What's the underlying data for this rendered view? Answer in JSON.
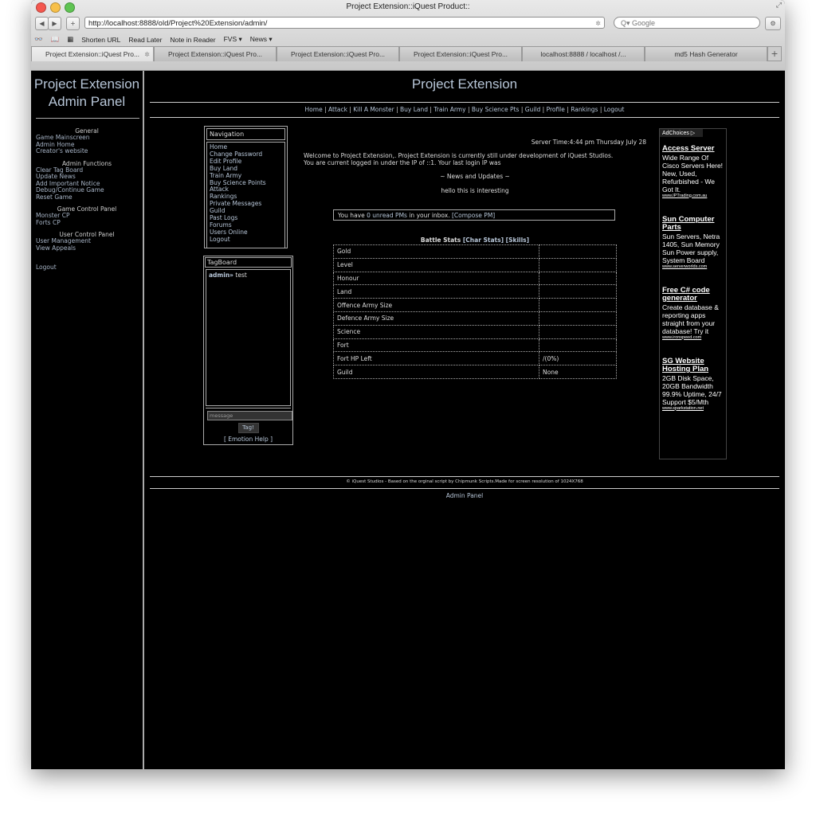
{
  "browser": {
    "title": "Project Extension::iQuest Product::",
    "url": "http://localhost:8888/old/Project%20Extension/admin/",
    "search_placeholder": "Q▾ Google",
    "bookmarks": [
      "Shorten URL",
      "Read Later",
      "Note in Reader",
      "FVS ▾",
      "News ▾"
    ],
    "tabs": [
      "Project Extension::iQuest Pro...",
      "Project Extension::iQuest Pro...",
      "Project Extension::iQuest Pro...",
      "Project Extension::iQuest Pro...",
      "localhost:8888 / localhost /...",
      "md5 Hash Generator"
    ]
  },
  "sidebar": {
    "title_line1": "Project Extension",
    "title_line2": "Admin Panel",
    "sections": [
      {
        "heading": "General",
        "links": [
          "Game Mainscreen",
          "Admin Home",
          "Creator's website"
        ]
      },
      {
        "heading": "Admin Functions",
        "links": [
          "Clear Tag Board",
          "Update News",
          "Add Important Notice",
          "Debug/Continue Game",
          "Reset Game"
        ]
      },
      {
        "heading": "Game Control Panel",
        "links": [
          "Monster CP",
          "Forts CP"
        ]
      },
      {
        "heading": "User Control Panel",
        "links": [
          "User Management",
          "View Appeals"
        ]
      }
    ],
    "logout": "Logout"
  },
  "main": {
    "title": "Project Extension",
    "topnav": [
      "Home",
      "Attack",
      "Kill A Monster",
      "Buy Land",
      "Train Army",
      "Buy Science Pts",
      "Guild",
      "Profile",
      "Rankings",
      "Logout"
    ],
    "server_time": "Server Time:4:44 pm Thursday July 28",
    "welcome_line1": "Welcome to Project Extension,. Project Extension is currently still under development of iQuest Studios.",
    "welcome_line2": "You are current logged in under the IP of ::1. Your last login IP was",
    "news_heading": "~ News and Updates ~",
    "news_text": "hello this is interesting",
    "inbox_prefix": "You have",
    "inbox_link": "0 unread PMs",
    "inbox_suffix": "in your inbox.",
    "compose": "[Compose PM]",
    "battle_stats_label": "Battle Stats",
    "char_stats_link": "[Char Stats]",
    "skills_link": "[Skills]",
    "stats": [
      {
        "label": "Gold",
        "value": ""
      },
      {
        "label": "Level",
        "value": ""
      },
      {
        "label": "Honour",
        "value": ""
      },
      {
        "label": "Land",
        "value": ""
      },
      {
        "label": "Offence Army Size",
        "value": ""
      },
      {
        "label": "Defence Army Size",
        "value": ""
      },
      {
        "label": "Science",
        "value": ""
      },
      {
        "label": "Fort",
        "value": ""
      },
      {
        "label": "Fort HP Left",
        "value": "/(0%)"
      },
      {
        "label": "Guild",
        "value": "None"
      }
    ],
    "footer": "© iQuest Studios - Based on the orginal script by Chipmunk Scripts.Made for screen resolution of 1024X768",
    "footer_link": "Admin Panel"
  },
  "navigation": {
    "heading": "Navigation",
    "links": [
      "Home",
      "Change Password",
      "Edit Profile",
      "Buy Land",
      "Train Army",
      "Buy Science Points",
      "Attack",
      "Rankings",
      "Private Messages",
      "Guild",
      "Past Logs",
      "Forums",
      "Users Online",
      "Logout"
    ]
  },
  "tagboard": {
    "heading": "TagBoard",
    "entry_user": "admin»",
    "entry_text": "test",
    "input_placeholder": "message",
    "button": "Tag!",
    "emotion_help": "[ Emotion Help ]"
  },
  "ads": {
    "choices_label": "AdChoices ▷",
    "items": [
      {
        "title": "Access Server",
        "text": "Wide Range Of Cisco Servers Here! New, Used, Refurbished - We Got It.",
        "url": "www.IPTrading.com.au"
      },
      {
        "title": "Sun Computer Parts",
        "text": "Sun Servers, Netra 1405, Sun Memory Sun Power supply, System Board",
        "url": "www.serverworlds.com"
      },
      {
        "title": "Free C# code generator",
        "text": "Create database & reporting apps straight from your database! Try it",
        "url": "www.ironspeed.com"
      },
      {
        "title": "SG Website Hosting Plan",
        "text": "2GB Disk Space, 20GB Bandwidth 99.9% Uptime, 24/7 Support $5/Mth",
        "url": "www.sparkstation.net"
      }
    ]
  }
}
